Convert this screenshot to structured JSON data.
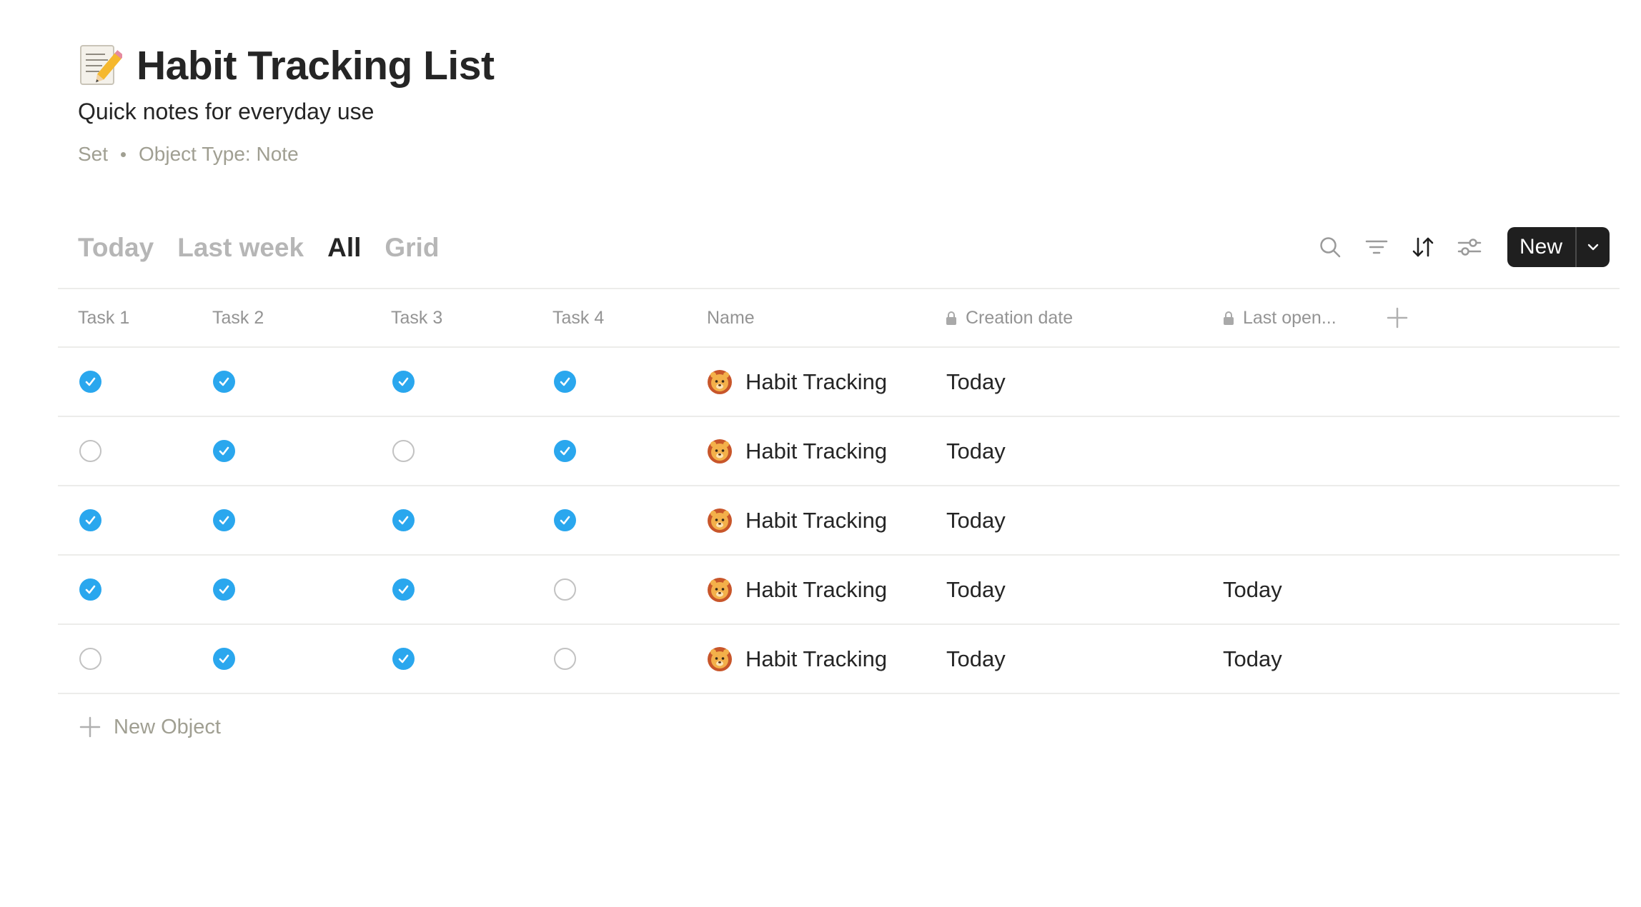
{
  "header": {
    "title": "Habit Tracking List",
    "title_icon": "memo-pencil-icon",
    "description": "Quick notes for everyday use",
    "meta_set": "Set",
    "meta_type": "Object Type: Note"
  },
  "views": {
    "tabs": [
      {
        "label": "Today",
        "active": false
      },
      {
        "label": "Last week",
        "active": false
      },
      {
        "label": "All",
        "active": true
      },
      {
        "label": "Grid",
        "active": false
      }
    ]
  },
  "toolbar": {
    "icons": [
      "search-icon",
      "filter-icon",
      "sort-icon",
      "settings-sliders-icon"
    ],
    "new_label": "New"
  },
  "table": {
    "columns": [
      {
        "label": "Task 1",
        "locked": false
      },
      {
        "label": "Task 2",
        "locked": false
      },
      {
        "label": "Task 3",
        "locked": false
      },
      {
        "label": "Task 4",
        "locked": false
      },
      {
        "label": "Name",
        "locked": false
      },
      {
        "label": "Creation date",
        "locked": true
      },
      {
        "label": "Last open...",
        "locked": true
      }
    ],
    "rows": [
      {
        "tasks": [
          true,
          true,
          true,
          true
        ],
        "name": "Habit Tracking",
        "icon": "lion-face-icon",
        "creation_date": "Today",
        "last_opened": ""
      },
      {
        "tasks": [
          false,
          true,
          false,
          true
        ],
        "name": "Habit Tracking",
        "icon": "lion-face-icon",
        "creation_date": "Today",
        "last_opened": ""
      },
      {
        "tasks": [
          true,
          true,
          true,
          true
        ],
        "name": "Habit Tracking",
        "icon": "lion-face-icon",
        "creation_date": "Today",
        "last_opened": ""
      },
      {
        "tasks": [
          true,
          true,
          true,
          false
        ],
        "name": "Habit Tracking",
        "icon": "lion-face-icon",
        "creation_date": "Today",
        "last_opened": "Today"
      },
      {
        "tasks": [
          false,
          true,
          true,
          false
        ],
        "name": "Habit Tracking",
        "icon": "lion-face-icon",
        "creation_date": "Today",
        "last_opened": "Today"
      }
    ],
    "add_label": "New Object"
  },
  "colors": {
    "checked": "#2aa7ee",
    "text": "#252525",
    "muted": "#a09f92",
    "button_bg": "#1f1f1f"
  }
}
